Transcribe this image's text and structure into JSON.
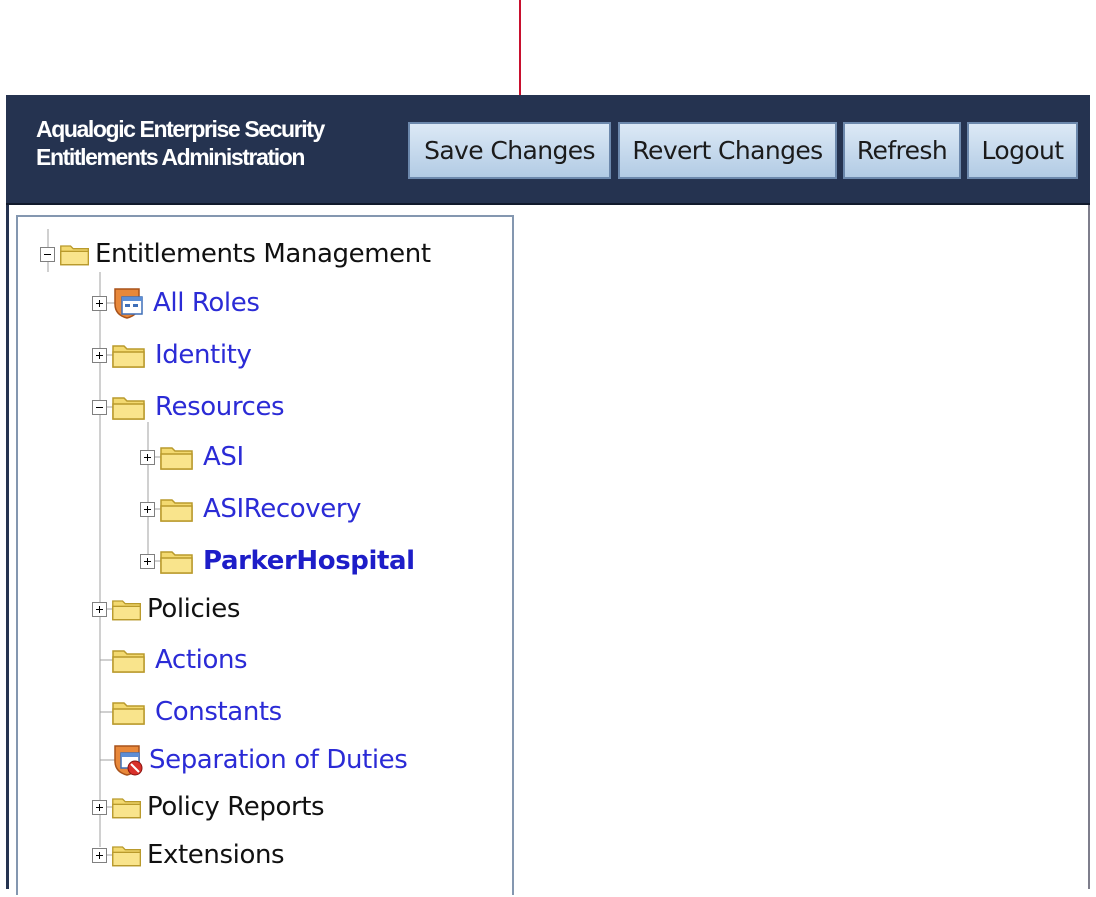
{
  "header": {
    "title_line1": "Aqualogic Enterprise Security",
    "title_line2": "Entitlements Administration",
    "buttons": {
      "save": "Save Changes",
      "revert": "Revert Changes",
      "refresh": "Refresh",
      "logout": "Logout"
    }
  },
  "tree": {
    "root": {
      "label": "Entitlements Management",
      "expanded": true,
      "icon": "folder-icon"
    },
    "items": [
      {
        "label": "All Roles",
        "icon": "roles-icon",
        "expander": "plus"
      },
      {
        "label": "Identity",
        "icon": "folder-icon",
        "expander": "plus"
      },
      {
        "label": "Resources",
        "icon": "folder-icon",
        "expander": "minus"
      },
      {
        "label": "ASI",
        "icon": "folder-icon",
        "expander": "plus"
      },
      {
        "label": "ASIRecovery",
        "icon": "folder-icon",
        "expander": "plus"
      },
      {
        "label": "ParkerHospital",
        "icon": "folder-icon",
        "expander": "plus",
        "selected": true
      },
      {
        "label": "Policies",
        "icon": "folder-icon",
        "expander": "plus"
      },
      {
        "label": "Actions",
        "icon": "folder-icon",
        "expander": "none"
      },
      {
        "label": "Constants",
        "icon": "folder-icon",
        "expander": "none"
      },
      {
        "label": "Separation of Duties",
        "icon": "separation-of-duties-icon",
        "expander": "none"
      },
      {
        "label": "Policy Reports",
        "icon": "folder-icon",
        "expander": "plus"
      },
      {
        "label": "Extensions",
        "icon": "folder-icon",
        "expander": "plus"
      }
    ]
  },
  "colors": {
    "header_bg": "#253350",
    "link_text": "#2b2bd6",
    "callout_line": "#c8102e"
  }
}
